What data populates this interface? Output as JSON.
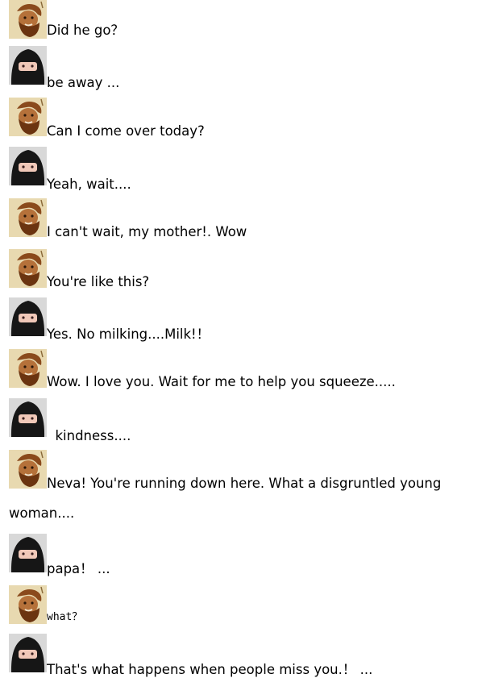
{
  "chat": {
    "messages": [
      {
        "sender": "man",
        "text": "Did he go？"
      },
      {
        "sender": "woman",
        "text": "be away ..."
      },
      {
        "sender": "man",
        "text": "Can I come over today?"
      },
      {
        "sender": "woman",
        "text": "Yeah, wait...."
      },
      {
        "sender": "man",
        "text": "I can't wait, my mother!. Wow"
      },
      {
        "sender": "man",
        "text": "You're like this?"
      },
      {
        "sender": "woman",
        "text": "Yes. No milking....Milk!！"
      },
      {
        "sender": "man",
        "text": "Wow. I love you. Wait for me to help you squeeze....."
      },
      {
        "sender": "woman",
        "text": "  kindness...."
      },
      {
        "sender": "man",
        "text": "Neva! You're running down here. What a disgruntled young",
        "continuation": "woman...."
      },
      {
        "sender": "woman",
        "text": "papa！ ..."
      },
      {
        "sender": "man",
        "text": "what？"
      },
      {
        "sender": "woman",
        "text": "That's what happens when people miss you.！ ..."
      }
    ]
  },
  "avatars": {
    "man": {
      "icon": "bearded-man-avatar-icon",
      "skin": "#b5713a",
      "beard": "#6b3410",
      "background": "#e8d9b0"
    },
    "woman": {
      "icon": "veiled-woman-avatar-icon",
      "veil": "#161616",
      "skin": "#f0c8b8",
      "background": "#d8d8d8"
    }
  }
}
